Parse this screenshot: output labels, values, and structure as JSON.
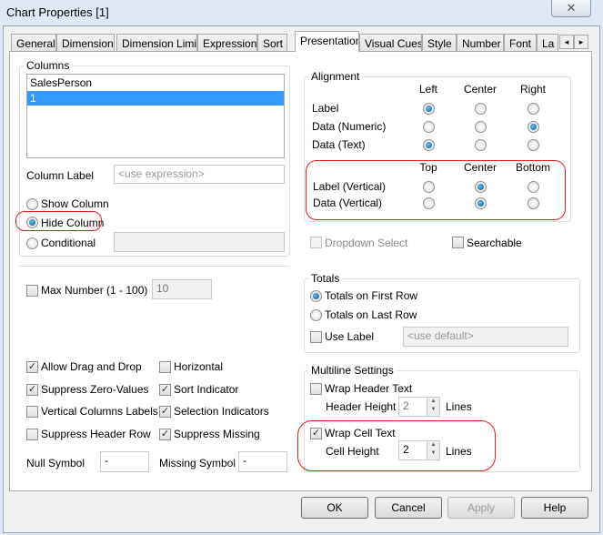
{
  "window": {
    "title": "Chart Properties [1]",
    "close": "✕"
  },
  "tabs": [
    "General",
    "Dimensions",
    "Dimension Limits",
    "Expressions",
    "Sort",
    "Presentation",
    "Visual Cues",
    "Style",
    "Number",
    "Font",
    "La"
  ],
  "tab_scroll": {
    "left": "◂",
    "right": "▸"
  },
  "columns": {
    "label": "Columns",
    "items": [
      "SalesPerson",
      "1"
    ],
    "selected": 1,
    "column_label": "Column Label",
    "column_label_placeholder": "<use expression>",
    "show_column": "Show Column",
    "hide_column": "Hide Column",
    "conditional": "Conditional",
    "visibility": "hide"
  },
  "alignment": {
    "label": "Alignment",
    "h_cols": [
      "Left",
      "Center",
      "Right"
    ],
    "rows": [
      {
        "label": "Label",
        "value": 0
      },
      {
        "label": "Data (Numeric)",
        "value": 2
      },
      {
        "label": "Data (Text)",
        "value": 0
      }
    ],
    "v_cols": [
      "Top",
      "Center",
      "Bottom"
    ],
    "v_rows": [
      {
        "label": "Label (Vertical)",
        "value": 1
      },
      {
        "label": "Data (Vertical)",
        "value": 1
      }
    ]
  },
  "dropdown_select": "Dropdown Select",
  "searchable": "Searchable",
  "max_number": {
    "label": "Max Number (1 - 100)",
    "value": "10"
  },
  "totals": {
    "label": "Totals",
    "first": "Totals on First Row",
    "last": "Totals on Last Row",
    "use_label": "Use Label",
    "placeholder": "<use default>"
  },
  "options": [
    {
      "label": "Allow Drag and Drop",
      "checked": true
    },
    {
      "label": "Horizontal",
      "checked": false
    },
    {
      "label": "Suppress Zero-Values",
      "checked": true
    },
    {
      "label": "Sort Indicator",
      "checked": true
    },
    {
      "label": "Vertical Columns Labels",
      "checked": false
    },
    {
      "label": "Selection Indicators",
      "checked": true
    },
    {
      "label": "Suppress Header Row",
      "checked": false
    },
    {
      "label": "Suppress Missing",
      "checked": true
    }
  ],
  "null_symbol": {
    "label": "Null Symbol",
    "value": "-"
  },
  "missing_symbol": {
    "label": "Missing Symbol",
    "value": "-"
  },
  "multiline": {
    "label": "Multiline Settings",
    "wrap_header": "Wrap Header Text",
    "header_height": "Header Height",
    "header_value": "2",
    "wrap_cell": "Wrap Cell Text",
    "cell_height": "Cell Height",
    "cell_value": "2",
    "lines": "Lines"
  },
  "buttons": {
    "ok": "OK",
    "cancel": "Cancel",
    "apply": "Apply",
    "help": "Help"
  },
  "annotation_color": "#e21b1b"
}
